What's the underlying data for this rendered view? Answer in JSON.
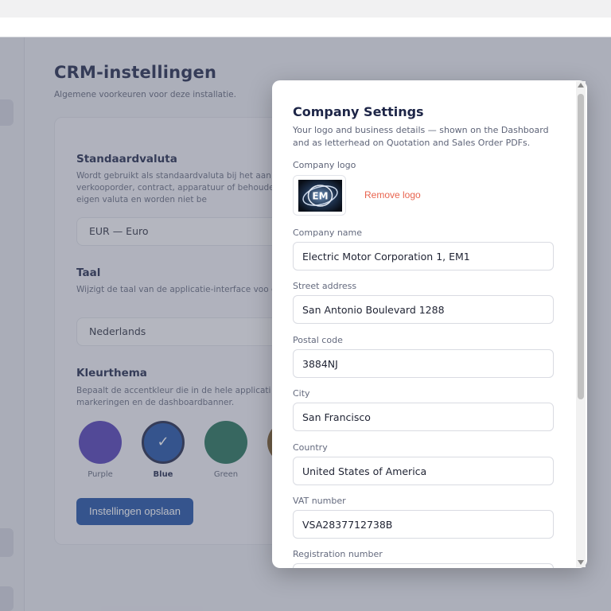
{
  "settings_page": {
    "title": "CRM-instellingen",
    "subtitle": "Algemene voorkeuren voor deze installatie.",
    "currency": {
      "title": "Standaardvaluta",
      "description": "Wordt gebruikt als standaardvaluta bij het aan offerte, verkooporder, contract, apparatuur of behouden hun eigen valuta en worden niet be",
      "value": "EUR — Euro"
    },
    "language": {
      "title": "Taal",
      "description": "Wijzigt de taal van de applicatie-interface voo gebruikt.",
      "value": "Nederlands"
    },
    "theme": {
      "title": "Kleurthema",
      "description": "Bepaalt de accentkleur die in de hele applicati markeringen en de dashboardbanner.",
      "options": [
        {
          "label": "Purple",
          "color": "#4e3bb4",
          "selected": false
        },
        {
          "label": "Blue",
          "color": "#1c4fa2",
          "selected": true
        },
        {
          "label": "Green",
          "color": "#1f6e55",
          "selected": false
        },
        {
          "label": "",
          "color": "#7a5a2a",
          "selected": false
        }
      ],
      "check_mark": "✓"
    },
    "save_label": "Instellingen opslaan"
  },
  "modal": {
    "title": "Company Settings",
    "description": "Your logo and business details — shown on the Dashboard and as letterhead on Quotation and Sales Order PDFs.",
    "logo_label": "Company logo",
    "logo_text": "EM",
    "remove_logo_label": "Remove logo",
    "fields": [
      {
        "label": "Company name",
        "value": "Electric Motor Corporation 1, EM1"
      },
      {
        "label": "Street address",
        "value": "San Antonio Boulevard 1288"
      },
      {
        "label": "Postal code",
        "value": "3884NJ"
      },
      {
        "label": "City",
        "value": "San Francisco"
      },
      {
        "label": "Country",
        "value": "United States of America"
      },
      {
        "label": "VAT number",
        "value": "VSA2837712738B"
      },
      {
        "label": "Registration number",
        "value": ""
      }
    ]
  }
}
